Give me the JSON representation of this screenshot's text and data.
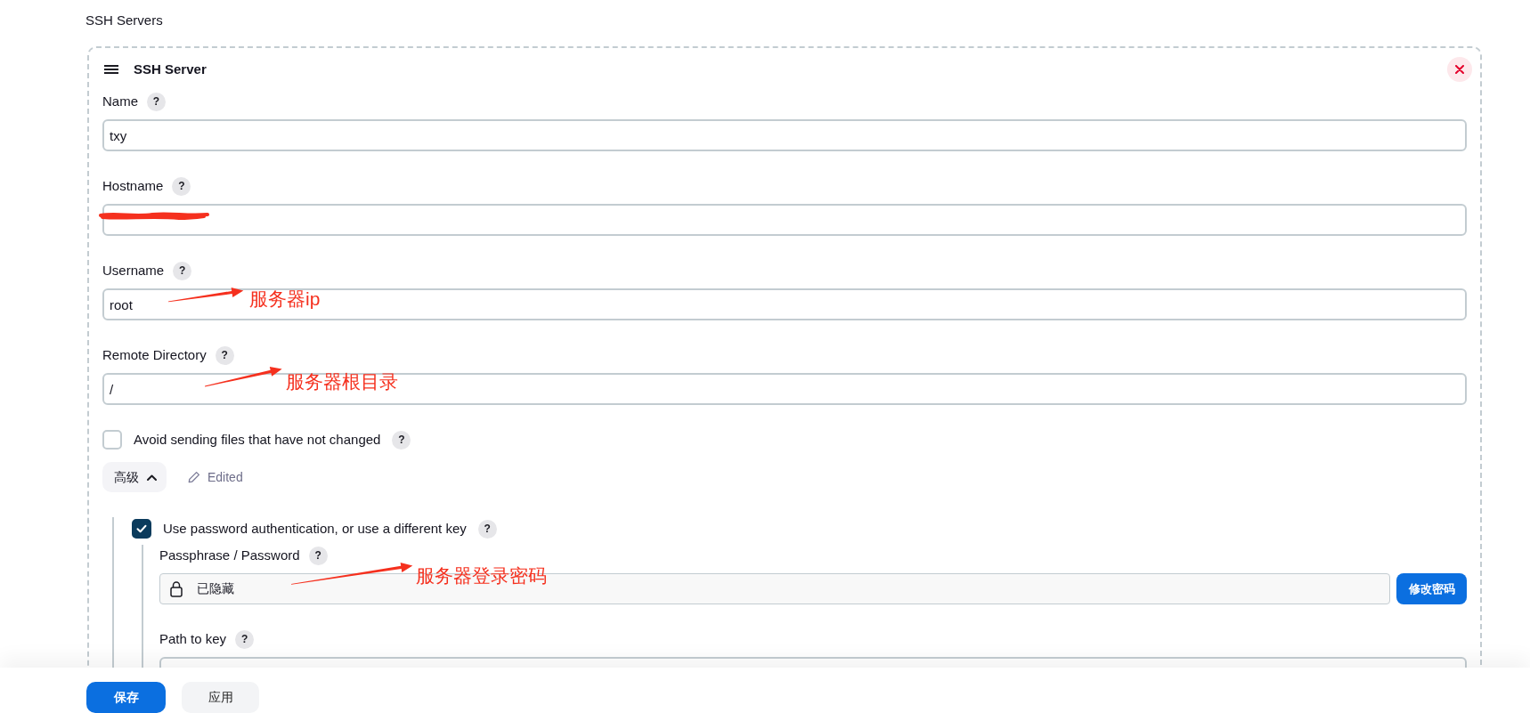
{
  "section_title": "SSH Servers",
  "server": {
    "title": "SSH Server",
    "fields": [
      {
        "label": "Name",
        "help": "?",
        "value": "txy",
        "redacted": false
      },
      {
        "label": "Hostname",
        "help": "?",
        "redacted": true
      },
      {
        "label": "Username",
        "help": "?",
        "value": "root",
        "redacted": false,
        "annotation": "服务器ip"
      },
      {
        "label": "Remote Directory",
        "help": "?",
        "value": "/",
        "redacted": false,
        "annotation": "服务器根目录"
      }
    ],
    "avoid_unchanged": {
      "label": "Avoid sending files that have not changed",
      "help": "?",
      "checked": false
    },
    "advanced": {
      "label": "高级",
      "expanded": true,
      "status": "Edited"
    },
    "password_auth": {
      "label": "Use password authentication, or use a different key",
      "help": "?",
      "checked": true,
      "passphrase": {
        "label": "Passphrase / Password",
        "help": "?",
        "value": "已隐藏",
        "button": "修改密码",
        "annotation": "服务器登录密码"
      },
      "path_to_key": {
        "label": "Path to key",
        "help": "?"
      }
    }
  },
  "footer": {
    "buttons": [
      {
        "label": "保存",
        "kind": "primary"
      },
      {
        "label": "应用",
        "kind": "secondary"
      }
    ]
  }
}
